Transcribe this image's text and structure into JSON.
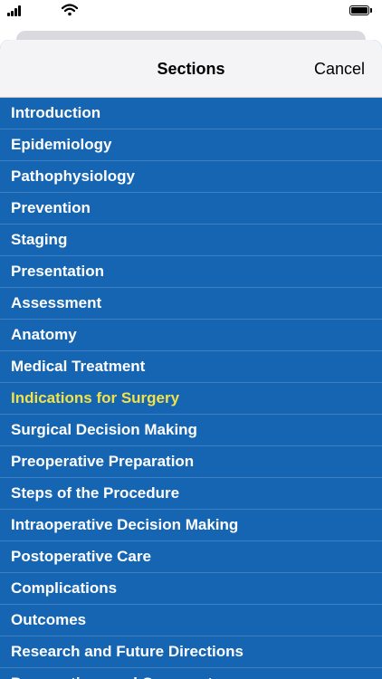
{
  "status_bar": {
    "icons": [
      "signal-icon",
      "wifi-icon",
      "battery-icon"
    ]
  },
  "nav": {
    "title": "Sections",
    "cancel_label": "Cancel"
  },
  "colors": {
    "list_background": "#1565b3",
    "row_text": "#ffffff",
    "selected_text": "#f2e24a",
    "nav_background": "#f4f4f6"
  },
  "sections": {
    "selected": "Indications for Surgery",
    "items": [
      "Introduction",
      "Epidemiology",
      "Pathophysiology",
      "Prevention",
      "Staging",
      "Presentation",
      "Assessment",
      "Anatomy",
      "Medical Treatment",
      "Indications for Surgery",
      "Surgical Decision Making",
      "Preoperative Preparation",
      "Steps of the Procedure",
      "Intraoperative Decision Making",
      "Postoperative Care",
      "Complications",
      "Outcomes",
      "Research and Future Directions",
      "Perspectives and Commentary"
    ]
  }
}
